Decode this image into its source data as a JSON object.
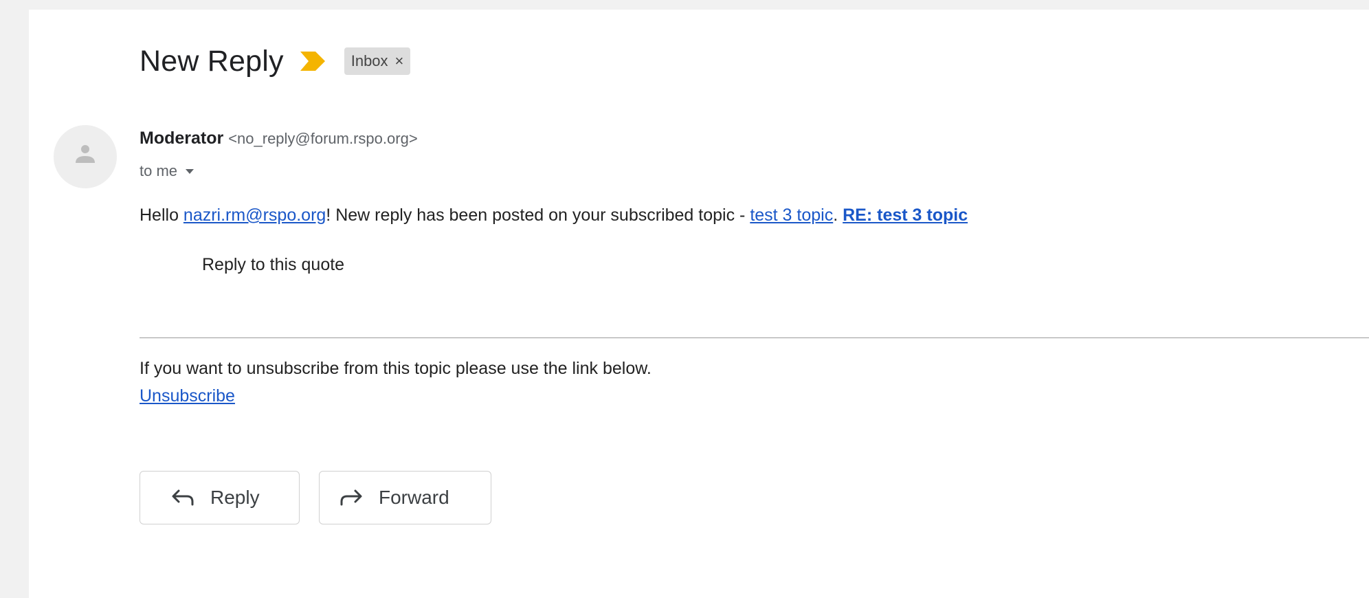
{
  "email": {
    "subject": "New Reply",
    "label": "Inbox",
    "label_close": "×",
    "sender_name": "Moderator",
    "sender_address": "<no_reply@forum.rspo.org>",
    "recipient": "to me",
    "body": {
      "greeting": "Hello ",
      "recipient_link": "nazri.rm@rspo.org",
      "message": "! New reply has been posted on your subscribed topic - ",
      "topic_link": "test 3 topic",
      "separator": ". ",
      "reply_link": "RE: test 3 topic",
      "quote": "Reply to this quote",
      "unsubscribe_text": "If you want to unsubscribe from this topic please use the link below.",
      "unsubscribe_link": "Unsubscribe"
    }
  },
  "actions": {
    "reply_label": "Reply",
    "forward_label": "Forward"
  },
  "colors": {
    "importance_marker": "#f4b400",
    "link": "#1a57c8",
    "label_chip_bg": "#dddddd"
  },
  "icons": {
    "importance": "importance-marker-icon",
    "avatar": "person-avatar-icon",
    "dropdown": "caret-down-icon",
    "reply": "reply-arrow-icon",
    "forward": "forward-arrow-icon"
  }
}
